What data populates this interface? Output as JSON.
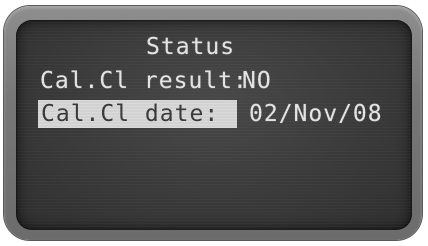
{
  "screen": {
    "title": "Status",
    "rows": [
      {
        "label": "Cal.Cl result:",
        "value": "NO",
        "selected": false
      },
      {
        "label": "Cal.Cl date:",
        "value": "02/Nov/08",
        "selected": true
      }
    ]
  },
  "colors": {
    "lcd_background": "#3b3b3b",
    "lcd_text": "#e8e8e8",
    "highlight_background": "#d9d9d9",
    "highlight_text": "#3a3a3a",
    "bezel": "#777777"
  }
}
